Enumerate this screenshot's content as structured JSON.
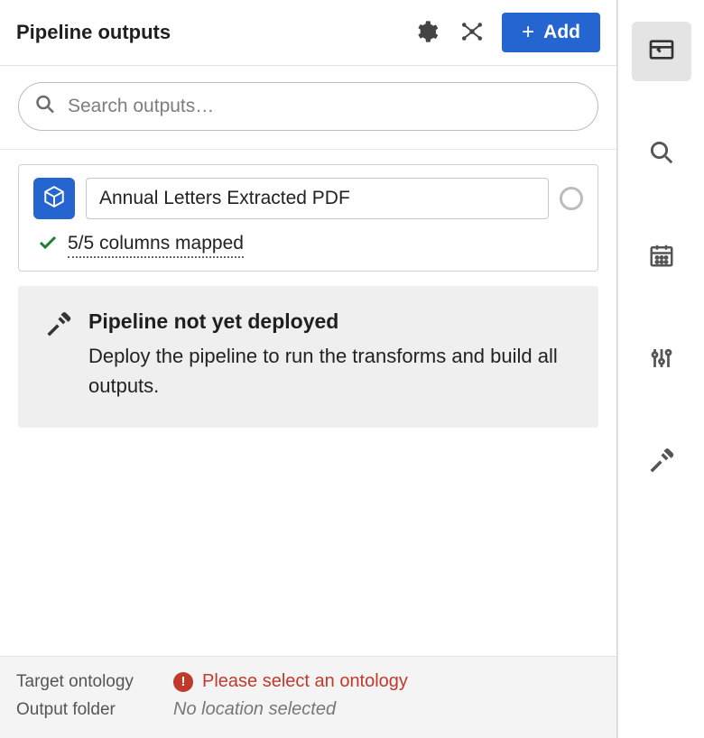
{
  "header": {
    "title": "Pipeline outputs",
    "add_label": "Add"
  },
  "search": {
    "placeholder": "Search outputs…",
    "value": ""
  },
  "output": {
    "name": "Annual Letters Extracted PDF",
    "mapped_text": "5/5 columns mapped"
  },
  "notice": {
    "title": "Pipeline not yet deployed",
    "body": "Deploy the pipeline to run the transforms and build all outputs."
  },
  "footer": {
    "target_ontology_label": "Target ontology",
    "target_ontology_error": "Please select an ontology",
    "output_folder_label": "Output folder",
    "output_folder_value": "No location selected"
  },
  "icons": {
    "gear": "gear-icon",
    "graph": "graph-icon",
    "plus": "plus-icon",
    "cube": "cube-icon",
    "check": "check-icon",
    "hammer": "hammer-icon",
    "error": "error-icon",
    "outputs_panel": "outputs-panel-icon",
    "search": "search-icon",
    "calendar": "calendar-icon",
    "sliders": "sliders-icon",
    "build": "build-icon"
  }
}
